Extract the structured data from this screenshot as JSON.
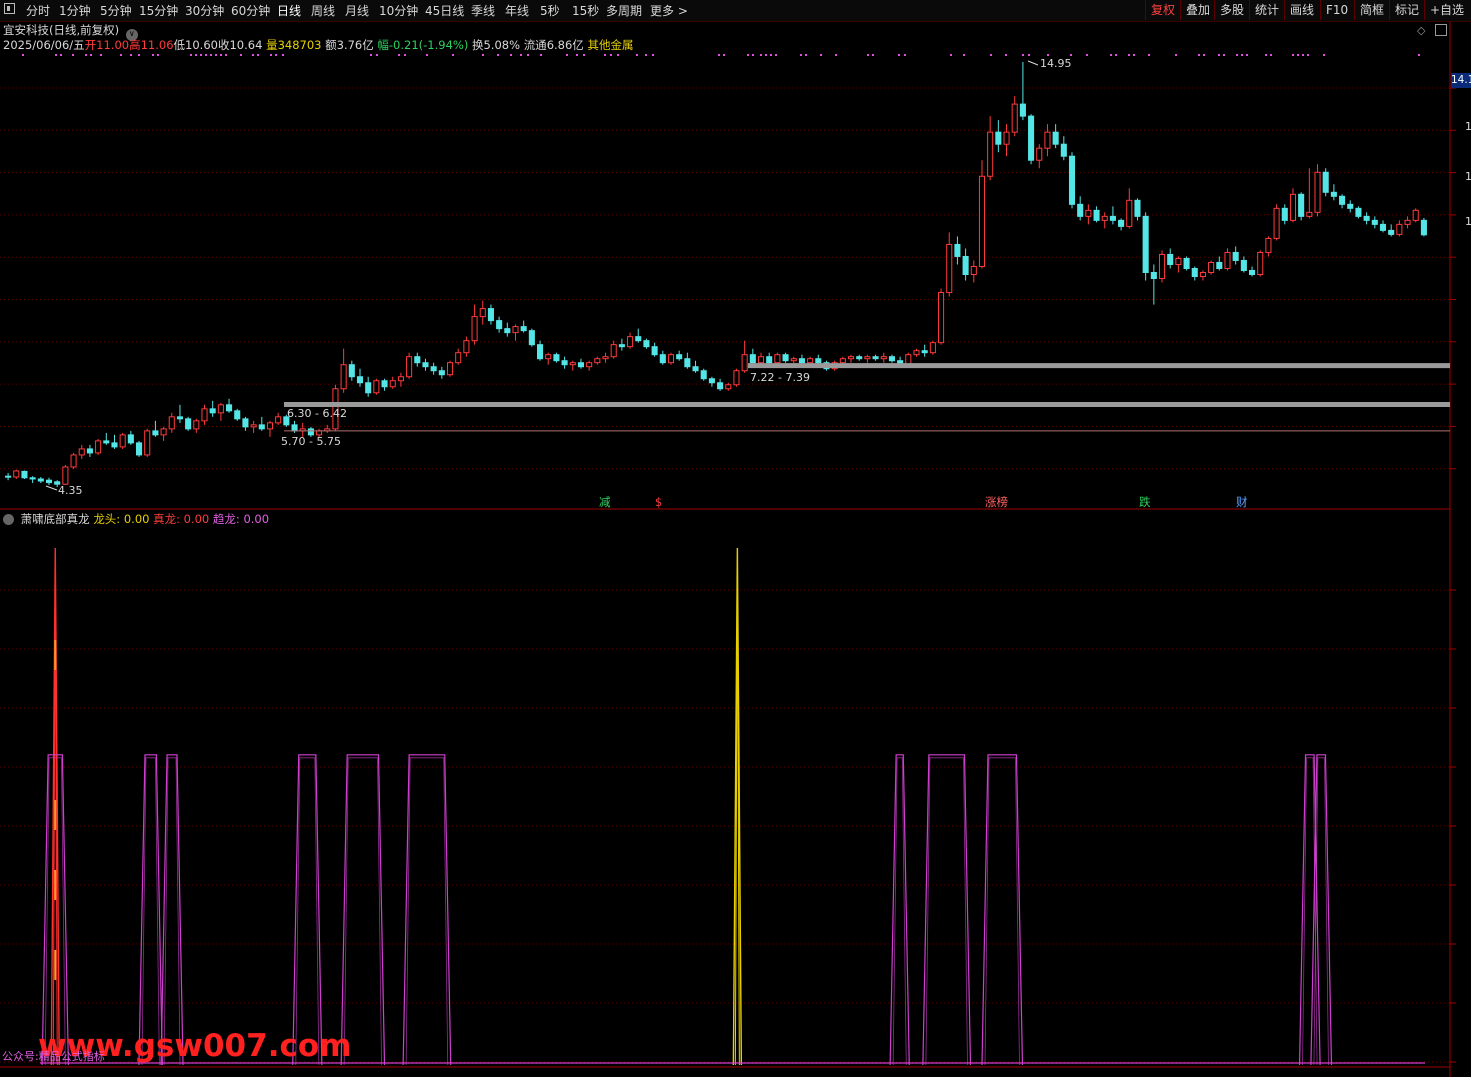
{
  "toolbar": {
    "period_tabs": [
      "分时",
      "1分钟",
      "5分钟",
      "15分钟",
      "30分钟",
      "60分钟",
      "日线",
      "周线",
      "月线",
      "10分钟",
      "45日线",
      "季线",
      "年线",
      "5秒",
      "15秒",
      "多周期",
      "更多 >"
    ],
    "active_period": "日线",
    "right_tabs": [
      "复权",
      "叠加",
      "多股",
      "统计",
      "画线",
      "F10",
      "简框",
      "标记",
      "+自选"
    ],
    "active_right": "复权"
  },
  "header": {
    "stock_title": "宜安科技(日线,前复权)",
    "date": "2025/06/06/五",
    "open_label": "开",
    "open": "11.00",
    "high_label": "高",
    "high": "11.06",
    "low_label": "低",
    "low": "10.60",
    "close_label": "收",
    "close": "10.64",
    "vol_label": "量",
    "vol": "348703",
    "amt_label": "额",
    "amt": "3.76亿",
    "chg_label": "幅",
    "chg": "-0.21(-1.94%)",
    "turnover_label": "换",
    "turnover": "5.08%",
    "float_label": "流通",
    "float": "6.86亿",
    "sector": "其他金属"
  },
  "price_scale_value": "14.1",
  "annotations": {
    "high_label": "14.95",
    "low_label": "4.35",
    "zone1": "6.30 - 6.42",
    "zone2": "5.70 - 5.75",
    "zone3": "7.22 - 7.39"
  },
  "event_tags": [
    {
      "text": "减",
      "color": "#30d060"
    },
    {
      "text": "$",
      "color": "#ff3b3b"
    },
    {
      "text": "涨榜",
      "color": "#ff6060"
    },
    {
      "text": "跌",
      "color": "#30d060"
    },
    {
      "text": "财",
      "color": "#5aa0ff"
    }
  ],
  "indicator": {
    "name": "萧啸底部真龙",
    "l1_label": "龙头:",
    "l1_value": "0.00",
    "l2_label": "真龙:",
    "l2_value": "0.00",
    "l3_label": "趋龙:",
    "l3_value": "0.00"
  },
  "watermark": {
    "text": "www.gsw007.com",
    "sub": "公众号:精品公式指标"
  },
  "colors": {
    "up": "#ff3b3b",
    "down": "#54e6e6",
    "grid": "#5a0000",
    "magenta": "#d040d0",
    "yellow": "#e8d000",
    "zone": "#9a9a9a"
  },
  "chart_data": {
    "type": "candlestick",
    "price_range": [
      4.35,
      14.95
    ],
    "support_zones": [
      {
        "label": "6.30 - 6.42",
        "low": 6.3,
        "high": 6.42
      },
      {
        "label": "5.70 - 5.75",
        "low": 5.7,
        "high": 5.75
      },
      {
        "label": "7.22 - 7.39",
        "low": 7.22,
        "high": 7.39
      }
    ],
    "candles": [
      [
        4.62,
        4.7,
        4.52,
        4.6
      ],
      [
        4.6,
        4.78,
        4.55,
        4.75
      ],
      [
        4.74,
        4.76,
        4.55,
        4.58
      ],
      [
        4.58,
        4.62,
        4.45,
        4.55
      ],
      [
        4.55,
        4.6,
        4.45,
        4.5
      ],
      [
        4.52,
        4.58,
        4.4,
        4.46
      ],
      [
        4.48,
        4.52,
        4.35,
        4.42
      ],
      [
        4.42,
        4.9,
        4.4,
        4.85
      ],
      [
        4.85,
        5.2,
        4.8,
        5.15
      ],
      [
        5.15,
        5.4,
        5.05,
        5.3
      ],
      [
        5.3,
        5.4,
        5.1,
        5.2
      ],
      [
        5.2,
        5.55,
        5.15,
        5.5
      ],
      [
        5.5,
        5.7,
        5.4,
        5.45
      ],
      [
        5.45,
        5.65,
        5.3,
        5.35
      ],
      [
        5.35,
        5.7,
        5.3,
        5.65
      ],
      [
        5.65,
        5.75,
        5.4,
        5.45
      ],
      [
        5.45,
        5.5,
        5.1,
        5.15
      ],
      [
        5.15,
        5.8,
        5.1,
        5.75
      ],
      [
        5.75,
        6.0,
        5.6,
        5.65
      ],
      [
        5.65,
        5.85,
        5.5,
        5.8
      ],
      [
        5.8,
        6.2,
        5.7,
        6.1
      ],
      [
        6.1,
        6.4,
        5.95,
        6.05
      ],
      [
        6.05,
        6.1,
        5.75,
        5.8
      ],
      [
        5.8,
        6.05,
        5.7,
        6.0
      ],
      [
        6.0,
        6.4,
        5.9,
        6.3
      ],
      [
        6.3,
        6.5,
        6.1,
        6.2
      ],
      [
        6.2,
        6.45,
        6.0,
        6.4
      ],
      [
        6.4,
        6.55,
        6.2,
        6.25
      ],
      [
        6.25,
        6.3,
        6.0,
        6.05
      ],
      [
        6.05,
        6.1,
        5.75,
        5.85
      ],
      [
        5.85,
        6.0,
        5.7,
        5.9
      ],
      [
        5.9,
        6.1,
        5.75,
        5.8
      ],
      [
        5.8,
        6.0,
        5.6,
        5.95
      ],
      [
        5.95,
        6.2,
        5.9,
        6.1
      ],
      [
        6.1,
        6.15,
        5.85,
        5.9
      ],
      [
        5.9,
        6.0,
        5.7,
        5.75
      ],
      [
        5.75,
        5.95,
        5.6,
        5.8
      ],
      [
        5.8,
        5.85,
        5.6,
        5.65
      ],
      [
        5.65,
        5.8,
        5.6,
        5.75
      ],
      [
        5.75,
        5.9,
        5.7,
        5.8
      ],
      [
        5.8,
        6.9,
        5.75,
        6.8
      ],
      [
        6.8,
        7.8,
        6.7,
        7.4
      ],
      [
        7.4,
        7.5,
        7.0,
        7.1
      ],
      [
        7.1,
        7.3,
        6.85,
        6.95
      ],
      [
        6.95,
        7.1,
        6.6,
        6.7
      ],
      [
        6.7,
        7.05,
        6.65,
        7.0
      ],
      [
        7.0,
        7.05,
        6.75,
        6.85
      ],
      [
        6.85,
        7.1,
        6.8,
        7.0
      ],
      [
        7.0,
        7.2,
        6.85,
        7.1
      ],
      [
        7.1,
        7.7,
        7.05,
        7.6
      ],
      [
        7.6,
        7.7,
        7.35,
        7.45
      ],
      [
        7.45,
        7.55,
        7.25,
        7.35
      ],
      [
        7.35,
        7.45,
        7.15,
        7.25
      ],
      [
        7.25,
        7.35,
        7.05,
        7.15
      ],
      [
        7.15,
        7.5,
        7.1,
        7.45
      ],
      [
        7.45,
        7.8,
        7.4,
        7.7
      ],
      [
        7.7,
        8.1,
        7.6,
        8.0
      ],
      [
        8.0,
        8.9,
        7.9,
        8.6
      ],
      [
        8.6,
        9.0,
        8.4,
        8.8
      ],
      [
        8.8,
        8.9,
        8.4,
        8.5
      ],
      [
        8.5,
        8.6,
        8.2,
        8.3
      ],
      [
        8.3,
        8.45,
        8.1,
        8.2
      ],
      [
        8.2,
        8.4,
        8.0,
        8.35
      ],
      [
        8.35,
        8.5,
        8.2,
        8.25
      ],
      [
        8.25,
        8.3,
        7.85,
        7.9
      ],
      [
        7.9,
        8.0,
        7.5,
        7.55
      ],
      [
        7.55,
        7.7,
        7.4,
        7.65
      ],
      [
        7.65,
        7.7,
        7.45,
        7.5
      ],
      [
        7.5,
        7.6,
        7.3,
        7.4
      ],
      [
        7.4,
        7.5,
        7.25,
        7.45
      ],
      [
        7.45,
        7.55,
        7.3,
        7.35
      ],
      [
        7.35,
        7.5,
        7.25,
        7.45
      ],
      [
        7.45,
        7.6,
        7.4,
        7.55
      ],
      [
        7.55,
        7.7,
        7.45,
        7.6
      ],
      [
        7.6,
        8.0,
        7.55,
        7.9
      ],
      [
        7.9,
        8.05,
        7.75,
        7.85
      ],
      [
        7.85,
        8.2,
        7.8,
        8.1
      ],
      [
        8.1,
        8.3,
        7.95,
        8.0
      ],
      [
        8.0,
        8.05,
        7.8,
        7.85
      ],
      [
        7.85,
        7.95,
        7.6,
        7.65
      ],
      [
        7.65,
        7.75,
        7.4,
        7.45
      ],
      [
        7.45,
        7.7,
        7.4,
        7.65
      ],
      [
        7.65,
        7.75,
        7.5,
        7.55
      ],
      [
        7.55,
        7.7,
        7.3,
        7.35
      ],
      [
        7.35,
        7.5,
        7.2,
        7.25
      ],
      [
        7.25,
        7.3,
        7.0,
        7.05
      ],
      [
        7.05,
        7.1,
        6.85,
        6.95
      ],
      [
        6.95,
        7.05,
        6.75,
        6.8
      ],
      [
        6.8,
        6.95,
        6.75,
        6.9
      ],
      [
        6.9,
        7.3,
        6.85,
        7.25
      ],
      [
        7.25,
        8.0,
        7.2,
        7.65
      ],
      [
        7.65,
        7.8,
        7.4,
        7.45
      ],
      [
        7.45,
        7.7,
        7.4,
        7.6
      ],
      [
        7.6,
        7.7,
        7.4,
        7.45
      ],
      [
        7.45,
        7.7,
        7.4,
        7.65
      ],
      [
        7.65,
        7.7,
        7.45,
        7.5
      ],
      [
        7.5,
        7.6,
        7.4,
        7.55
      ],
      [
        7.55,
        7.65,
        7.4,
        7.45
      ],
      [
        7.45,
        7.6,
        7.35,
        7.55
      ],
      [
        7.55,
        7.65,
        7.4,
        7.45
      ],
      [
        7.45,
        7.5,
        7.25,
        7.3
      ],
      [
        7.3,
        7.5,
        7.25,
        7.45
      ],
      [
        7.45,
        7.6,
        7.4,
        7.55
      ],
      [
        7.55,
        7.65,
        7.45,
        7.6
      ],
      [
        7.6,
        7.65,
        7.5,
        7.55
      ],
      [
        7.55,
        7.65,
        7.45,
        7.6
      ],
      [
        7.6,
        7.65,
        7.5,
        7.55
      ],
      [
        7.55,
        7.7,
        7.45,
        7.6
      ],
      [
        7.6,
        7.65,
        7.45,
        7.5
      ],
      [
        7.5,
        7.6,
        7.35,
        7.4
      ],
      [
        7.4,
        7.7,
        7.35,
        7.65
      ],
      [
        7.65,
        7.8,
        7.6,
        7.75
      ],
      [
        7.75,
        7.9,
        7.6,
        7.7
      ],
      [
        7.7,
        8.0,
        7.65,
        7.95
      ],
      [
        7.95,
        9.3,
        7.9,
        9.2
      ],
      [
        9.2,
        10.7,
        9.1,
        10.4
      ],
      [
        10.4,
        10.6,
        9.9,
        10.1
      ],
      [
        10.1,
        10.3,
        9.5,
        9.65
      ],
      [
        9.65,
        10.0,
        9.45,
        9.85
      ],
      [
        9.85,
        12.5,
        9.8,
        12.1
      ],
      [
        12.1,
        13.6,
        12.0,
        13.2
      ],
      [
        13.2,
        13.5,
        12.7,
        12.9
      ],
      [
        12.9,
        13.4,
        12.6,
        13.2
      ],
      [
        13.2,
        14.1,
        13.1,
        13.9
      ],
      [
        13.9,
        14.95,
        13.5,
        13.6
      ],
      [
        13.6,
        13.65,
        12.4,
        12.5
      ],
      [
        12.5,
        12.9,
        12.3,
        12.8
      ],
      [
        12.8,
        13.4,
        12.6,
        13.2
      ],
      [
        13.2,
        13.4,
        12.8,
        12.9
      ],
      [
        12.9,
        13.1,
        12.5,
        12.6
      ],
      [
        12.6,
        12.7,
        11.3,
        11.4
      ],
      [
        11.4,
        11.6,
        11.0,
        11.1
      ],
      [
        11.1,
        11.4,
        10.9,
        11.25
      ],
      [
        11.25,
        11.35,
        10.95,
        11.0
      ],
      [
        11.0,
        11.2,
        10.8,
        11.1
      ],
      [
        11.1,
        11.35,
        10.9,
        11.0
      ],
      [
        11.0,
        11.05,
        10.75,
        10.85
      ],
      [
        10.85,
        11.8,
        10.8,
        11.5
      ],
      [
        11.5,
        11.55,
        11.0,
        11.1
      ],
      [
        11.1,
        11.2,
        9.5,
        9.7
      ],
      [
        9.7,
        9.9,
        8.9,
        9.55
      ],
      [
        9.55,
        10.25,
        9.45,
        10.15
      ],
      [
        10.15,
        10.3,
        9.8,
        9.9
      ],
      [
        9.9,
        10.1,
        9.7,
        10.05
      ],
      [
        10.05,
        10.1,
        9.75,
        9.8
      ],
      [
        9.8,
        9.85,
        9.5,
        9.6
      ],
      [
        9.6,
        9.75,
        9.5,
        9.7
      ],
      [
        9.7,
        10.0,
        9.65,
        9.95
      ],
      [
        9.95,
        10.1,
        9.75,
        9.8
      ],
      [
        9.8,
        10.3,
        9.75,
        10.2
      ],
      [
        10.2,
        10.35,
        9.9,
        10.0
      ],
      [
        10.0,
        10.1,
        9.7,
        9.75
      ],
      [
        9.75,
        9.85,
        9.6,
        9.65
      ],
      [
        9.65,
        10.25,
        9.6,
        10.2
      ],
      [
        10.2,
        10.6,
        10.1,
        10.55
      ],
      [
        10.55,
        11.4,
        10.5,
        11.3
      ],
      [
        11.3,
        11.4,
        10.9,
        11.0
      ],
      [
        11.0,
        11.8,
        10.95,
        11.65
      ],
      [
        11.65,
        11.7,
        11.0,
        11.1
      ],
      [
        11.1,
        12.3,
        11.05,
        11.2
      ],
      [
        11.2,
        12.4,
        11.1,
        12.2
      ],
      [
        12.2,
        12.3,
        11.6,
        11.7
      ],
      [
        11.7,
        11.9,
        11.5,
        11.6
      ],
      [
        11.6,
        11.65,
        11.3,
        11.4
      ],
      [
        11.4,
        11.5,
        11.2,
        11.3
      ],
      [
        11.3,
        11.35,
        11.05,
        11.1
      ],
      [
        11.1,
        11.2,
        10.9,
        11.0
      ],
      [
        11.0,
        11.1,
        10.8,
        10.9
      ],
      [
        10.9,
        11.0,
        10.7,
        10.75
      ],
      [
        10.75,
        10.9,
        10.6,
        10.65
      ],
      [
        10.65,
        11.0,
        10.6,
        10.9
      ],
      [
        10.9,
        11.1,
        10.8,
        11.0
      ],
      [
        11.0,
        11.3,
        10.95,
        11.25
      ],
      [
        11.0,
        11.06,
        10.6,
        10.64
      ]
    ],
    "indicator_series": [
      {
        "name": "龙头",
        "color": "#e8d000",
        "pulses": [
          [
            0.515,
            1.0
          ]
        ]
      },
      {
        "name": "真龙",
        "color": "#ff3030",
        "pulses": [
          [
            0.036,
            1.0
          ]
        ]
      },
      {
        "name": "趋龙",
        "color": "#d040d0",
        "pulses": [
          [
            0.036,
            0.6
          ],
          [
            0.103,
            0.6
          ],
          [
            0.118,
            0.6
          ],
          [
            0.213,
            0.6
          ],
          [
            0.252,
            0.6
          ],
          [
            0.297,
            0.6
          ],
          [
            0.629,
            0.6
          ],
          [
            0.662,
            0.6
          ],
          [
            0.701,
            0.6
          ],
          [
            0.917,
            0.6
          ],
          [
            0.925,
            0.6
          ]
        ],
        "widths": [
          0.01,
          0.008,
          0.007,
          0.012,
          0.022,
          0.025,
          0.005,
          0.025,
          0.02,
          0.006,
          0.006
        ]
      }
    ]
  }
}
